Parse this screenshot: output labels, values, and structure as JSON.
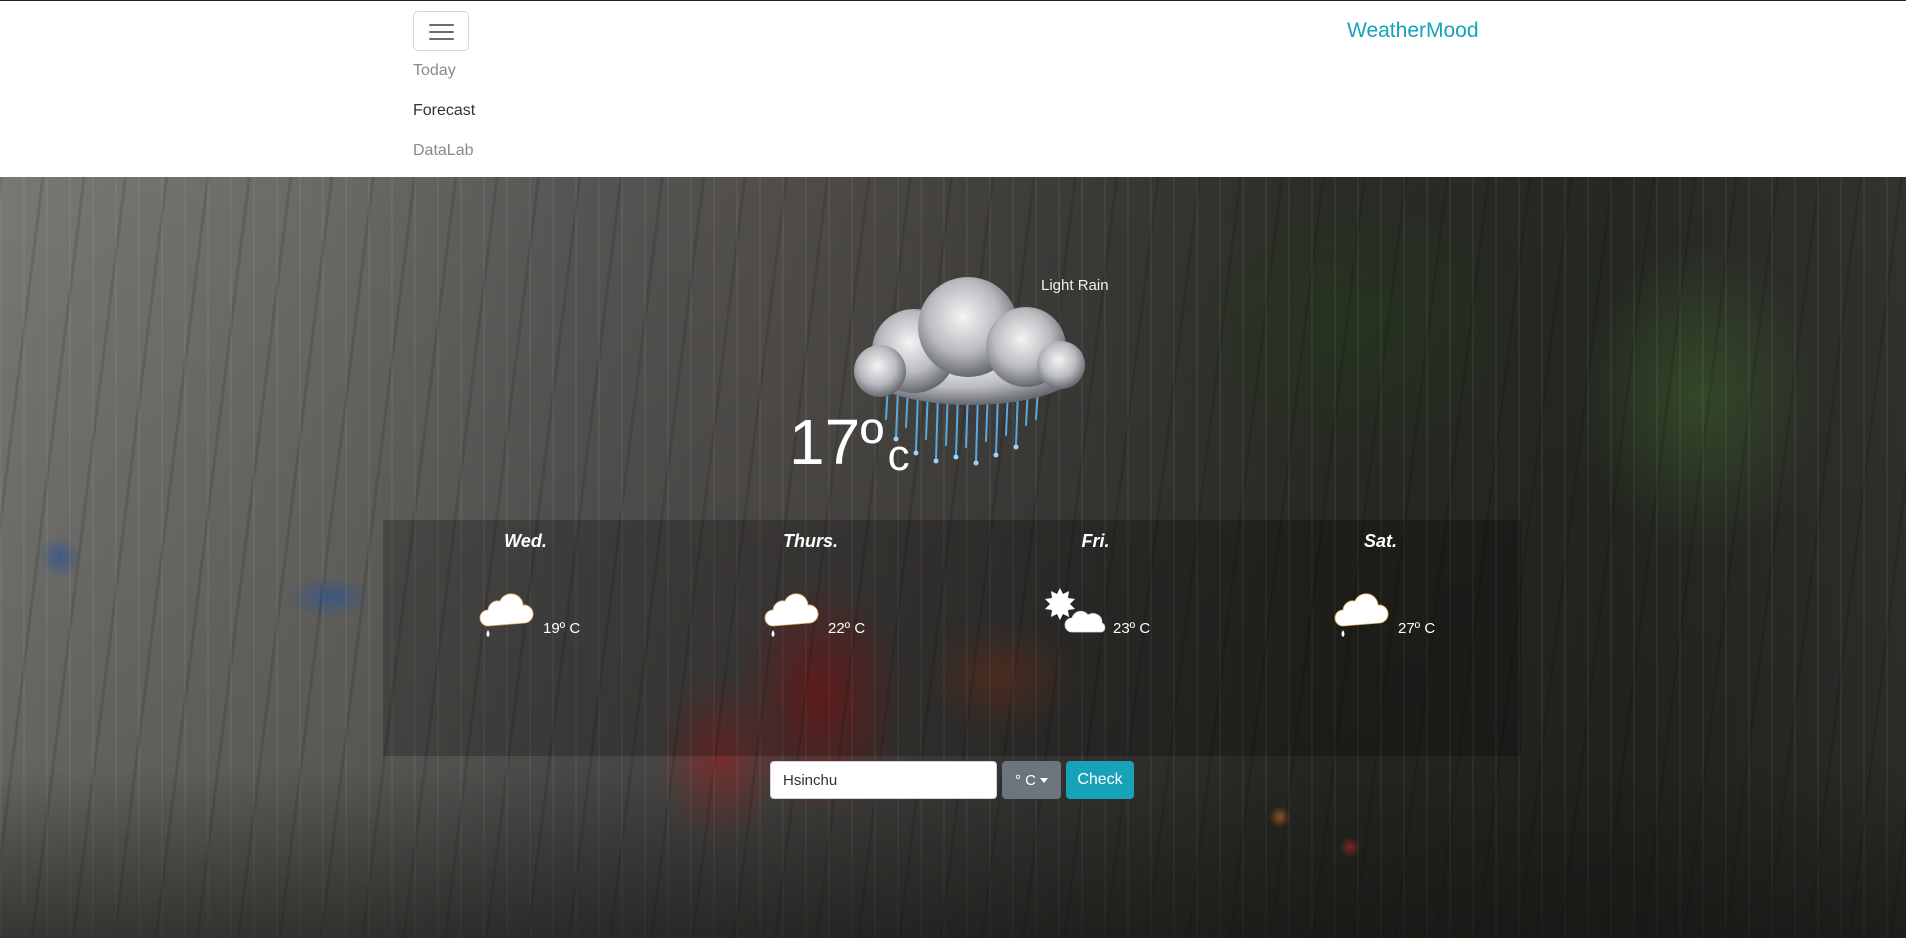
{
  "app": {
    "brand": "WeatherMood"
  },
  "nav": {
    "toggle_icon": "menu-icon",
    "items": [
      {
        "label": "Today",
        "active": false
      },
      {
        "label": "Forecast",
        "active": true
      },
      {
        "label": "DataLab",
        "active": false
      }
    ]
  },
  "current": {
    "condition": "Light Rain",
    "icon": "rain-cloud-icon",
    "temp": "17º",
    "unit": "c"
  },
  "forecast": [
    {
      "day": "Wed.",
      "temp": "19º C",
      "icon": "rain-cloud-icon"
    },
    {
      "day": "Thurs.",
      "temp": "22º C",
      "icon": "rain-cloud-icon"
    },
    {
      "day": "Fri.",
      "temp": "23º C",
      "icon": "partly-sunny-icon"
    },
    {
      "day": "Sat.",
      "temp": "27º C",
      "icon": "rain-cloud-icon"
    }
  ],
  "search": {
    "city_value": "Hsinchu",
    "unit_label": "° C",
    "check_label": "Check"
  },
  "colors": {
    "brand": "#17a2b8",
    "check_button": "#17a2b8",
    "unit_button": "#6c757d"
  }
}
